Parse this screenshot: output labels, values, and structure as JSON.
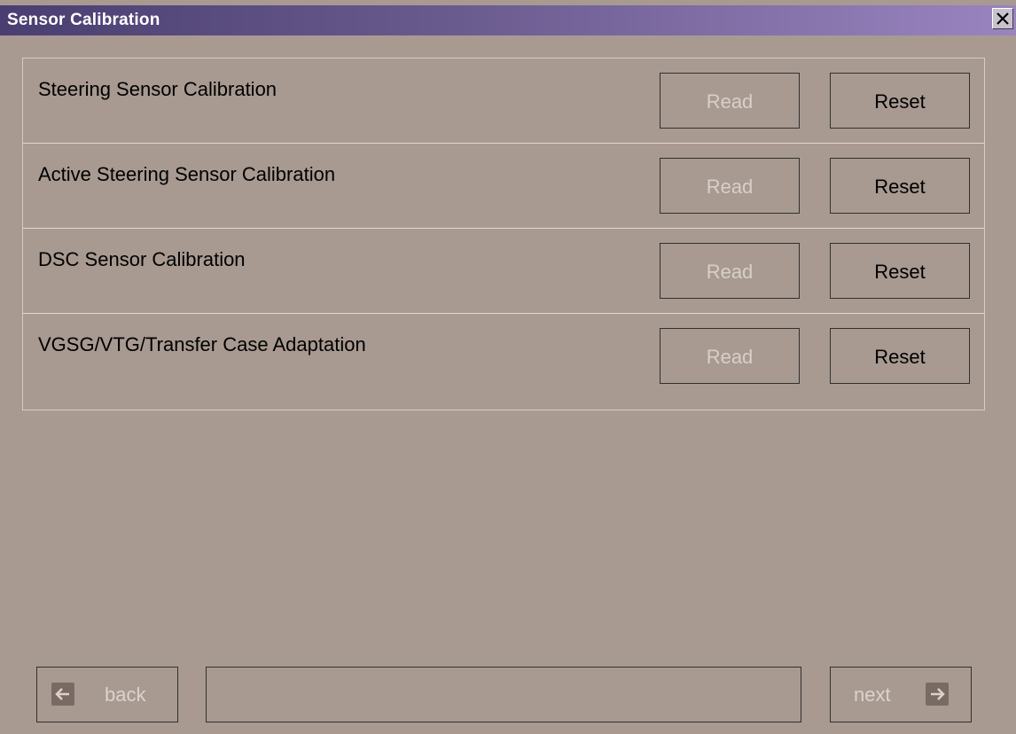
{
  "window": {
    "title": "Sensor Calibration",
    "close_icon": "close-icon"
  },
  "rows": [
    {
      "label": "Steering Sensor Calibration",
      "read_label": "Read",
      "reset_label": "Reset"
    },
    {
      "label": "Active Steering Sensor Calibration",
      "read_label": "Read",
      "reset_label": "Reset"
    },
    {
      "label": "DSC Sensor Calibration",
      "read_label": "Read",
      "reset_label": "Reset"
    },
    {
      "label": "VGSG/VTG/Transfer Case Adaptation",
      "read_label": "Read",
      "reset_label": "Reset"
    }
  ],
  "footer": {
    "back_label": "back",
    "next_label": "next",
    "back_icon": "arrow-left-icon",
    "next_icon": "arrow-right-icon",
    "status_text": ""
  },
  "colors": {
    "background": "#a89a91",
    "titlebar_start": "#4a3e70",
    "titlebar_end": "#9a84c0",
    "disabled_text": "#d8cfc9"
  }
}
